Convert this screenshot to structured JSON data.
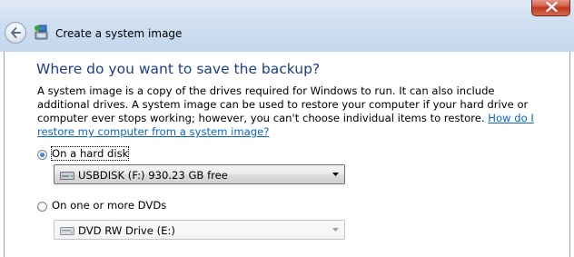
{
  "window": {
    "title": "Create a system image"
  },
  "main": {
    "heading": "Where do you want to save the backup?",
    "description": "A system image is a copy of the drives required for Windows to run. It can also include additional drives. A system image can be used to restore your computer if your hard drive or computer ever stops working; however, you can't choose individual items to restore.",
    "help_link": "How do I restore my computer from a system image?"
  },
  "options": {
    "hard_disk": {
      "label": "On a hard disk",
      "selected": true,
      "value": "USBDISK (F:)  930.23 GB free"
    },
    "dvd": {
      "label": "On one or more DVDs",
      "selected": false,
      "value": "DVD RW Drive (E:)"
    }
  },
  "icons": {
    "back": "back-arrow-icon",
    "title": "system-image-backup-icon",
    "close": "close-icon",
    "hard_disk": "hard-drive-icon",
    "dvd": "dvd-drive-icon"
  },
  "colors": {
    "heading": "#1c3e8c",
    "link": "#0a66cc",
    "close": "#c0391f"
  }
}
